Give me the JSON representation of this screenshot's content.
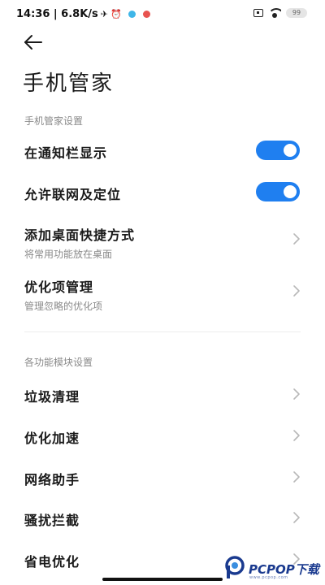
{
  "status_bar": {
    "time_speed": "14:36 | 6.8K/s",
    "battery": "99"
  },
  "header": {
    "title": "手机管家"
  },
  "section_phone_manager": {
    "header": "手机管家设置",
    "items": [
      {
        "title": "在通知栏显示",
        "toggle_on": true
      },
      {
        "title": "允许联网及定位",
        "toggle_on": true
      },
      {
        "title": "添加桌面快捷方式",
        "subtitle": "将常用功能放在桌面"
      },
      {
        "title": "优化项管理",
        "subtitle": "管理忽略的优化项"
      }
    ]
  },
  "section_modules": {
    "header": "各功能模块设置",
    "items": [
      {
        "title": "垃圾清理"
      },
      {
        "title": "优化加速"
      },
      {
        "title": "网络助手"
      },
      {
        "title": "骚扰拦截"
      },
      {
        "title": "省电优化"
      }
    ]
  },
  "watermark": {
    "brand": "PCPOP下载",
    "sub": "www.pcpop.com"
  },
  "colors": {
    "accent": "#1f7ff0",
    "secondary_text": "#8a8a8a"
  },
  "icons": {
    "back": "arrow-left-icon",
    "chevron": "chevron-right-icon"
  }
}
